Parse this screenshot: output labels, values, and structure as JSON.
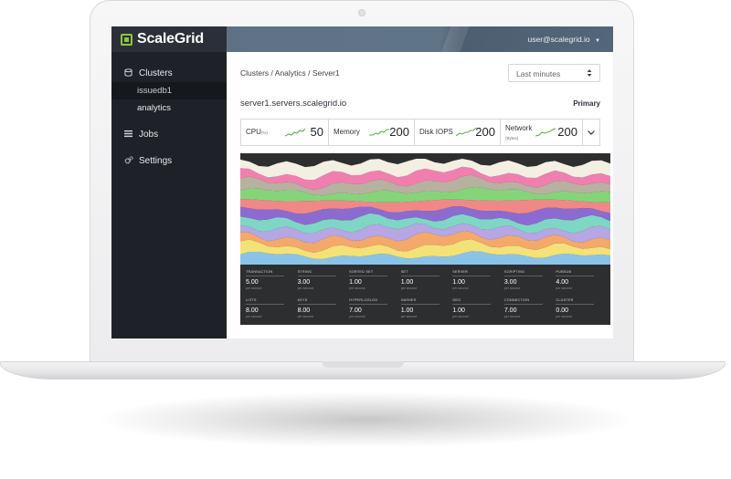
{
  "app": {
    "brand": "ScaleGrid",
    "user_email": "user@scalegrid.io",
    "accent": "#8ec641"
  },
  "sidebar": {
    "items": [
      {
        "label": "Clusters",
        "icon": "database-icon"
      },
      {
        "label": "issuedb1",
        "sub": true,
        "active": true
      },
      {
        "label": "analytics",
        "sub": true
      },
      {
        "label": "Jobs",
        "icon": "list-icon"
      },
      {
        "label": "Settings",
        "icon": "gears-icon"
      }
    ]
  },
  "header": {
    "breadcrumb": "Clusters / Analytics / Server1",
    "time_range": "Last minutes",
    "server_name": "server1.servers.scalegrid.io",
    "role": "Primary"
  },
  "metrics": [
    {
      "name": "CPU",
      "unit": "(%)",
      "value": "50"
    },
    {
      "name": "Memory",
      "unit": "",
      "value": "200"
    },
    {
      "name": "Disk IOPS",
      "unit": "",
      "value": "200"
    },
    {
      "name": "Network",
      "unit": "(Bytes)",
      "value": "200"
    }
  ],
  "chart": {
    "stats": [
      {
        "label": "TRANSACTION",
        "value": "5.00",
        "unit": "per second"
      },
      {
        "label": "STRING",
        "value": "3.00",
        "unit": "per second"
      },
      {
        "label": "SORTED SET",
        "value": "1.00",
        "unit": "per second"
      },
      {
        "label": "SET",
        "value": "1.00",
        "unit": "per second"
      },
      {
        "label": "SERVER",
        "value": "1.00",
        "unit": "per second"
      },
      {
        "label": "SCRIPTING",
        "value": "3.00",
        "unit": "per second"
      },
      {
        "label": "PUBSUB",
        "value": "4.00",
        "unit": "per second"
      },
      {
        "label": "LISTS",
        "value": "8.00",
        "unit": "per second"
      },
      {
        "label": "KEYS",
        "value": "8.00",
        "unit": "per second"
      },
      {
        "label": "HYPERLOGLOG",
        "value": "7.00",
        "unit": "per second"
      },
      {
        "label": "HASHES",
        "value": "1.00",
        "unit": "per second"
      },
      {
        "label": "GEO",
        "value": "1.00",
        "unit": "per second"
      },
      {
        "label": "CONNECTION",
        "value": "7.00",
        "unit": "per second"
      },
      {
        "label": "CLUSTER",
        "value": "0.00",
        "unit": "per second"
      }
    ],
    "stream_colors": [
      "#8ac3e8",
      "#f2e278",
      "#f4a86a",
      "#b6a6e3",
      "#7fd6c4",
      "#8c6bd1",
      "#f08888",
      "#86d47a",
      "#b7b1a0",
      "#f07fb0",
      "#f3efe3"
    ]
  }
}
